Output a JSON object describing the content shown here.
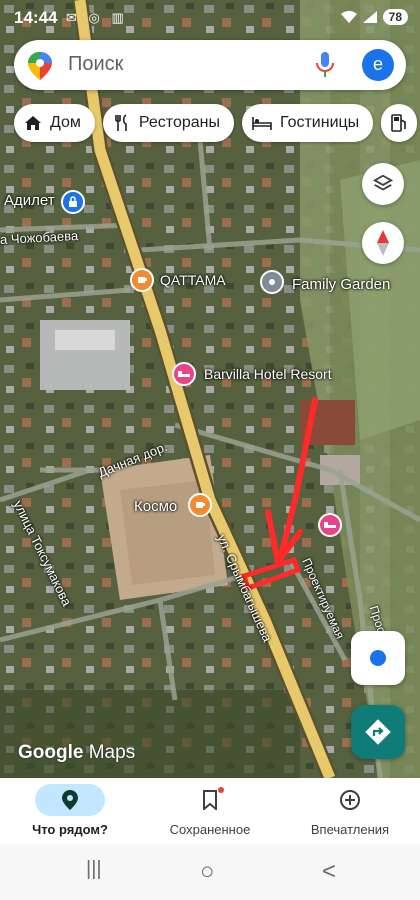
{
  "status_bar": {
    "time": "14:44",
    "left_icons": "✉ ◎ ▥",
    "battery": "78",
    "signal": "📶"
  },
  "search": {
    "placeholder": "Поиск",
    "avatar_letter": "е"
  },
  "chips": [
    {
      "label": "Дом",
      "icon": "home-icon"
    },
    {
      "label": "Рестораны",
      "icon": "restaurant-icon"
    },
    {
      "label": "Гостиницы",
      "icon": "hotel-icon"
    },
    {
      "label": "",
      "icon": "gas-station-icon"
    }
  ],
  "map": {
    "labels": {
      "adilet": "Адилет",
      "chozhobaeva": "а Чожобаева",
      "qattama": "QATTAMA",
      "family_garden": "Family Garden",
      "barvilla": "Barvilla Hotel Resort",
      "dachnaya": "Дачная дор.",
      "kosmo": "Космо",
      "toksumakova": "улица Токсумакова",
      "sryngbaeva": "ул. Срымбагышева",
      "proektiruemaya": "Проектируемая",
      "proselok": "Просёлок"
    },
    "logo_google": "Google",
    "logo_maps": "Maps",
    "colors": {
      "road_yellow": "#e7c86a",
      "annotation_red": "#ff2a2a",
      "poi_orange": "#f28b30",
      "poi_pink": "#e8448c",
      "poi_blue": "#1a73e8",
      "poi_gray": "#7f8b96"
    }
  },
  "bottom_nav": [
    {
      "label": "Что рядом?",
      "icon": "location-pin-icon",
      "active": true
    },
    {
      "label": "Сохраненное",
      "icon": "bookmark-icon",
      "active": false
    },
    {
      "label": "Впечатления",
      "icon": "add-circle-icon",
      "active": false
    }
  ],
  "system_nav": {
    "recents": "|||",
    "home": "○",
    "back": "<"
  }
}
